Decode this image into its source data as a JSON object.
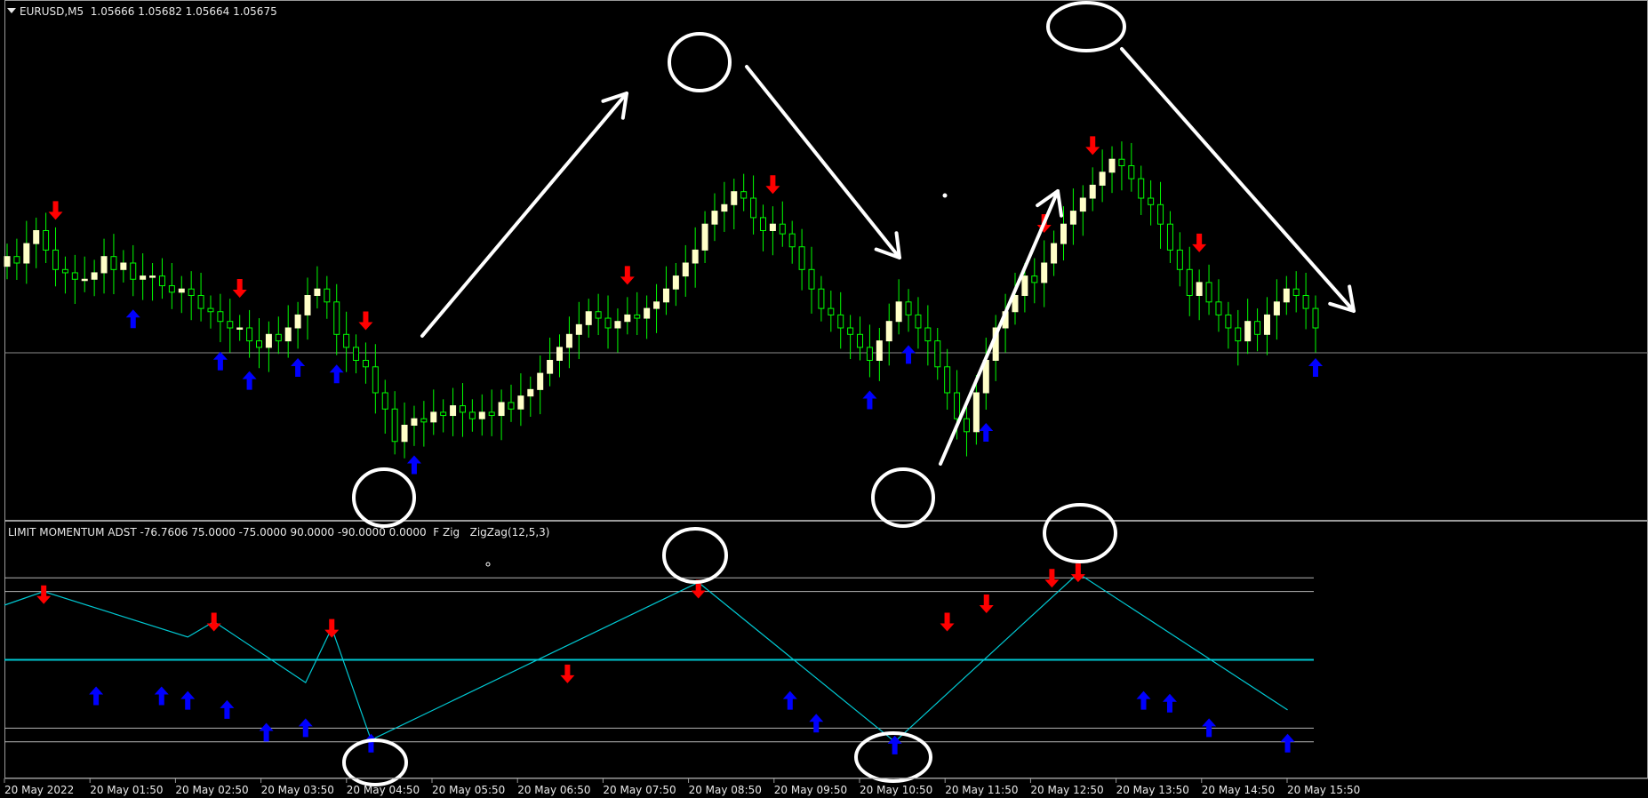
{
  "chart_window": {
    "symbol_header": "EURUSD,M5  1.05666 1.05682 1.05664 1.05675",
    "indicator_header": "LIMIT MOMENTUM ADST -76.7606 75.0000 -75.0000 90.0000 -90.0000 0.0000  F Zig   ZigZag(12,5,3)"
  },
  "colors": {
    "background": "#000000",
    "bull_candle": "#ffffc8",
    "bear_candle": "#00ff00",
    "wick": "#00ff00",
    "up_arrow": "#0000ff",
    "down_arrow": "#ff0000",
    "zigzag": "#00c8d2",
    "level_lines": "#b4b4b4",
    "annotation": "#ffffff"
  },
  "time_axis": {
    "labels": [
      "20 May 2022",
      "20 May 01:50",
      "20 May 02:50",
      "20 May 03:50",
      "20 May 04:50",
      "20 May 05:50",
      "20 May 06:50",
      "20 May 07:50",
      "20 May 08:50",
      "20 May 09:50",
      "20 May 10:50",
      "20 May 11:50",
      "20 May 12:50",
      "20 May 13:50",
      "20 May 14:50",
      "20 May 15:50"
    ]
  },
  "chart_data": [
    {
      "type": "candlestick",
      "title": "EURUSD,M5",
      "price_series_close": [
        0.62,
        0.6,
        0.66,
        0.7,
        0.64,
        0.58,
        0.57,
        0.55,
        0.55,
        0.57,
        0.62,
        0.58,
        0.6,
        0.55,
        0.56,
        0.56,
        0.53,
        0.51,
        0.52,
        0.5,
        0.46,
        0.45,
        0.42,
        0.4,
        0.4,
        0.36,
        0.34,
        0.38,
        0.36,
        0.4,
        0.44,
        0.5,
        0.52,
        0.48,
        0.38,
        0.34,
        0.3,
        0.28,
        0.2,
        0.15,
        0.05,
        0.1,
        0.12,
        0.11,
        0.14,
        0.13,
        0.16,
        0.14,
        0.12,
        0.14,
        0.13,
        0.17,
        0.15,
        0.19,
        0.21,
        0.26,
        0.3,
        0.34,
        0.38,
        0.41,
        0.45,
        0.43,
        0.4,
        0.42,
        0.44,
        0.43,
        0.46,
        0.48,
        0.52,
        0.56,
        0.6,
        0.64,
        0.72,
        0.76,
        0.78,
        0.82,
        0.8,
        0.74,
        0.7,
        0.72,
        0.69,
        0.65,
        0.58,
        0.52,
        0.46,
        0.44,
        0.4,
        0.38,
        0.34,
        0.3,
        0.36,
        0.42,
        0.48,
        0.44,
        0.4,
        0.36,
        0.28,
        0.2,
        0.12,
        0.08,
        0.2,
        0.3,
        0.4,
        0.45,
        0.5,
        0.56,
        0.54,
        0.6,
        0.66,
        0.72,
        0.76,
        0.8,
        0.84,
        0.88,
        0.92,
        0.9,
        0.86,
        0.8,
        0.78,
        0.72,
        0.64,
        0.58,
        0.5,
        0.54,
        0.48,
        0.44,
        0.4,
        0.36,
        0.42,
        0.38,
        0.44,
        0.48,
        0.52,
        0.5,
        0.46,
        0.4
      ],
      "up_signals_bar": [
        13,
        22,
        25,
        30,
        34,
        42,
        89,
        93,
        101,
        135,
        140,
        141,
        161,
        166,
        170
      ],
      "down_signals_bar": [
        5,
        24,
        37,
        64,
        79,
        107,
        112,
        123
      ],
      "ylim": [
        0,
        1
      ]
    },
    {
      "type": "line",
      "title": "LIMIT MOMENTUM ADST",
      "levels": [
        90.0,
        75.0,
        0.0,
        -75.0,
        -90.0
      ],
      "zigzag_points": [
        {
          "t": 0.0,
          "v": 60
        },
        {
          "t": 0.03,
          "v": 75
        },
        {
          "t": 0.14,
          "v": 25
        },
        {
          "t": 0.16,
          "v": 42
        },
        {
          "t": 0.23,
          "v": -25
        },
        {
          "t": 0.25,
          "v": 35
        },
        {
          "t": 0.28,
          "v": -88
        },
        {
          "t": 0.53,
          "v": 85
        },
        {
          "t": 0.68,
          "v": -90
        },
        {
          "t": 0.82,
          "v": 95
        },
        {
          "t": 0.98,
          "v": -55
        }
      ]
    }
  ]
}
